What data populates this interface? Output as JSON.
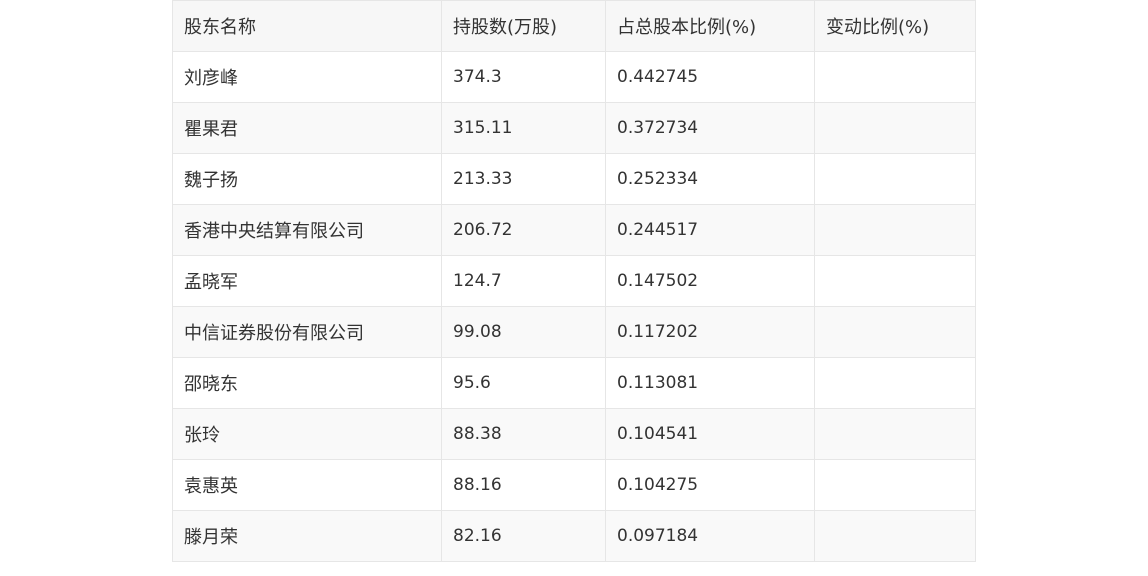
{
  "table": {
    "headers": [
      "股东名称",
      "持股数(万股)",
      "占总股本比例(%)",
      "变动比例(%)"
    ],
    "rows": [
      {
        "name": "刘彦峰",
        "shares": "374.3",
        "ratio": "0.442745",
        "change": ""
      },
      {
        "name": "瞿果君",
        "shares": "315.11",
        "ratio": "0.372734",
        "change": ""
      },
      {
        "name": "魏子扬",
        "shares": "213.33",
        "ratio": "0.252334",
        "change": ""
      },
      {
        "name": "香港中央结算有限公司",
        "shares": "206.72",
        "ratio": "0.244517",
        "change": ""
      },
      {
        "name": "孟晓军",
        "shares": "124.7",
        "ratio": "0.147502",
        "change": ""
      },
      {
        "name": "中信证券股份有限公司",
        "shares": "99.08",
        "ratio": "0.117202",
        "change": ""
      },
      {
        "name": "邵晓东",
        "shares": "95.6",
        "ratio": "0.113081",
        "change": ""
      },
      {
        "name": "张玲",
        "shares": "88.38",
        "ratio": "0.104541",
        "change": ""
      },
      {
        "name": "袁惠英",
        "shares": "88.16",
        "ratio": "0.104275",
        "change": ""
      },
      {
        "name": "滕月荣",
        "shares": "82.16",
        "ratio": "0.097184",
        "change": ""
      }
    ]
  }
}
